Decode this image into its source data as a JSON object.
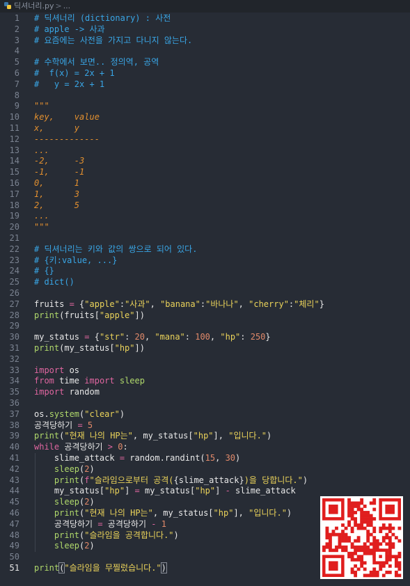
{
  "breadcrumb": {
    "filename": "딕셔너리.py",
    "separator": ">",
    "ellipsis": "..."
  },
  "brand": {
    "qr_color": "#e01e1e"
  },
  "current_line": 51,
  "lines": [
    {
      "n": 1,
      "tokens": [
        [
          "comment",
          "# 딕셔너리 (dictionary) : 사전"
        ]
      ]
    },
    {
      "n": 2,
      "tokens": [
        [
          "comment",
          "# apple -> 사과"
        ]
      ]
    },
    {
      "n": 3,
      "tokens": [
        [
          "comment",
          "# 요즘에는 사전을 가지고 다니지 않는다."
        ]
      ]
    },
    {
      "n": 4,
      "tokens": []
    },
    {
      "n": 5,
      "tokens": [
        [
          "comment",
          "# 수학에서 보면.. 정의역, 공역"
        ]
      ]
    },
    {
      "n": 6,
      "tokens": [
        [
          "comment",
          "#  f(x) = 2x + 1"
        ]
      ]
    },
    {
      "n": 7,
      "tokens": [
        [
          "comment",
          "#   y = 2x + 1"
        ]
      ]
    },
    {
      "n": 8,
      "tokens": []
    },
    {
      "n": 9,
      "tokens": [
        [
          "doc",
          "\"\"\""
        ]
      ]
    },
    {
      "n": 10,
      "tokens": [
        [
          "doc",
          "key,    value"
        ]
      ]
    },
    {
      "n": 11,
      "tokens": [
        [
          "doc",
          "x,      y"
        ]
      ]
    },
    {
      "n": 12,
      "tokens": [
        [
          "doc",
          "-------------"
        ]
      ]
    },
    {
      "n": 13,
      "tokens": [
        [
          "doc",
          "..."
        ]
      ]
    },
    {
      "n": 14,
      "tokens": [
        [
          "doc",
          "-2,     -3"
        ]
      ]
    },
    {
      "n": 15,
      "tokens": [
        [
          "doc",
          "-1,     -1"
        ]
      ]
    },
    {
      "n": 16,
      "tokens": [
        [
          "doc",
          "0,      1"
        ]
      ]
    },
    {
      "n": 17,
      "tokens": [
        [
          "doc",
          "1,      3"
        ]
      ]
    },
    {
      "n": 18,
      "tokens": [
        [
          "doc",
          "2,      5"
        ]
      ]
    },
    {
      "n": 19,
      "tokens": [
        [
          "doc",
          "..."
        ]
      ]
    },
    {
      "n": 20,
      "tokens": [
        [
          "doc",
          "\"\"\""
        ]
      ]
    },
    {
      "n": 21,
      "tokens": []
    },
    {
      "n": 22,
      "tokens": [
        [
          "comment",
          "# 딕셔너리는 키와 값의 쌍으로 되어 있다."
        ]
      ]
    },
    {
      "n": 23,
      "tokens": [
        [
          "comment",
          "# {키:value, ...}"
        ]
      ]
    },
    {
      "n": 24,
      "tokens": [
        [
          "comment",
          "# {}"
        ]
      ]
    },
    {
      "n": 25,
      "tokens": [
        [
          "comment",
          "# dict()"
        ]
      ]
    },
    {
      "n": 26,
      "tokens": []
    },
    {
      "n": 27,
      "tokens": [
        [
          "plain",
          "fruits "
        ],
        [
          "op",
          "="
        ],
        [
          "plain",
          " {"
        ],
        [
          "str",
          "\"apple\""
        ],
        [
          "plain",
          ":"
        ],
        [
          "str",
          "\"사과\""
        ],
        [
          "plain",
          ", "
        ],
        [
          "str",
          "\"banana\""
        ],
        [
          "plain",
          ":"
        ],
        [
          "str",
          "\"바나나\""
        ],
        [
          "plain",
          ", "
        ],
        [
          "str",
          "\"cherry\""
        ],
        [
          "plain",
          ":"
        ],
        [
          "str",
          "\"체리\""
        ],
        [
          "plain",
          "}"
        ]
      ]
    },
    {
      "n": 28,
      "tokens": [
        [
          "fn",
          "print"
        ],
        [
          "plain",
          "(fruits["
        ],
        [
          "str",
          "\"apple\""
        ],
        [
          "plain",
          "])"
        ]
      ]
    },
    {
      "n": 29,
      "tokens": []
    },
    {
      "n": 30,
      "tokens": [
        [
          "plain",
          "my_status "
        ],
        [
          "op",
          "="
        ],
        [
          "plain",
          " {"
        ],
        [
          "str",
          "\"str\""
        ],
        [
          "plain",
          ": "
        ],
        [
          "num",
          "20"
        ],
        [
          "plain",
          ", "
        ],
        [
          "str",
          "\"mana\""
        ],
        [
          "plain",
          ": "
        ],
        [
          "num",
          "100"
        ],
        [
          "plain",
          ", "
        ],
        [
          "str",
          "\"hp\""
        ],
        [
          "plain",
          ": "
        ],
        [
          "num",
          "250"
        ],
        [
          "plain",
          "}"
        ]
      ]
    },
    {
      "n": 31,
      "tokens": [
        [
          "fn",
          "print"
        ],
        [
          "plain",
          "(my_status["
        ],
        [
          "str",
          "\"hp\""
        ],
        [
          "plain",
          "])"
        ]
      ]
    },
    {
      "n": 32,
      "tokens": []
    },
    {
      "n": 33,
      "tokens": [
        [
          "kw",
          "import"
        ],
        [
          "plain",
          " os"
        ]
      ]
    },
    {
      "n": 34,
      "tokens": [
        [
          "kw",
          "from"
        ],
        [
          "plain",
          " time "
        ],
        [
          "kw",
          "import"
        ],
        [
          "plain",
          " "
        ],
        [
          "fn",
          "sleep"
        ]
      ]
    },
    {
      "n": 35,
      "tokens": [
        [
          "kw",
          "import"
        ],
        [
          "plain",
          " random"
        ]
      ]
    },
    {
      "n": 36,
      "tokens": []
    },
    {
      "n": 37,
      "tokens": [
        [
          "plain",
          "os."
        ],
        [
          "fn",
          "system"
        ],
        [
          "plain",
          "("
        ],
        [
          "str",
          "\"clear\""
        ],
        [
          "plain",
          ")"
        ]
      ]
    },
    {
      "n": 38,
      "tokens": [
        [
          "plain",
          "공격당하기 "
        ],
        [
          "op",
          "="
        ],
        [
          "plain",
          " "
        ],
        [
          "num",
          "5"
        ]
      ]
    },
    {
      "n": 39,
      "tokens": [
        [
          "fn",
          "print"
        ],
        [
          "plain",
          "("
        ],
        [
          "str",
          "\"현재 나의 HP는\""
        ],
        [
          "plain",
          ", my_status["
        ],
        [
          "str",
          "\"hp\""
        ],
        [
          "plain",
          "], "
        ],
        [
          "str",
          "\"입니다.\""
        ],
        [
          "plain",
          ")"
        ]
      ]
    },
    {
      "n": 40,
      "tokens": [
        [
          "kw",
          "while"
        ],
        [
          "plain",
          " 공격당하기 "
        ],
        [
          "op",
          ">"
        ],
        [
          "plain",
          " "
        ],
        [
          "num",
          "0"
        ],
        [
          "plain",
          ":"
        ]
      ]
    },
    {
      "n": 41,
      "tokens": [
        [
          "plain",
          "    slime_attack "
        ],
        [
          "op",
          "="
        ],
        [
          "plain",
          " random.randint("
        ],
        [
          "num",
          "15"
        ],
        [
          "plain",
          ", "
        ],
        [
          "num",
          "30"
        ],
        [
          "plain",
          ")"
        ]
      ]
    },
    {
      "n": 42,
      "tokens": [
        [
          "plain",
          "    "
        ],
        [
          "fn",
          "sleep"
        ],
        [
          "plain",
          "("
        ],
        [
          "num",
          "2"
        ],
        [
          "plain",
          ")"
        ]
      ]
    },
    {
      "n": 43,
      "tokens": [
        [
          "plain",
          "    "
        ],
        [
          "fn",
          "print"
        ],
        [
          "plain",
          "("
        ],
        [
          "kw",
          "f"
        ],
        [
          "str",
          "\"슬라임으로부터 공격("
        ],
        [
          "plain",
          "{slime_attack}"
        ],
        [
          "str",
          ")을 당합니다.\""
        ],
        [
          "plain",
          ")"
        ]
      ]
    },
    {
      "n": 44,
      "tokens": [
        [
          "plain",
          "    my_status["
        ],
        [
          "str",
          "\"hp\""
        ],
        [
          "plain",
          "] "
        ],
        [
          "op",
          "="
        ],
        [
          "plain",
          " my_status["
        ],
        [
          "str",
          "\"hp\""
        ],
        [
          "plain",
          "] "
        ],
        [
          "op",
          "-"
        ],
        [
          "plain",
          " slime_attack"
        ]
      ]
    },
    {
      "n": 45,
      "tokens": [
        [
          "plain",
          "    "
        ],
        [
          "fn",
          "sleep"
        ],
        [
          "plain",
          "("
        ],
        [
          "num",
          "2"
        ],
        [
          "plain",
          ")"
        ]
      ]
    },
    {
      "n": 46,
      "tokens": [
        [
          "plain",
          "    "
        ],
        [
          "fn",
          "print"
        ],
        [
          "plain",
          "("
        ],
        [
          "str",
          "\"현재 나의 HP는\""
        ],
        [
          "plain",
          ", my_status["
        ],
        [
          "str",
          "\"hp\""
        ],
        [
          "plain",
          "], "
        ],
        [
          "str",
          "\"입니다.\""
        ],
        [
          "plain",
          ")"
        ]
      ]
    },
    {
      "n": 47,
      "tokens": [
        [
          "plain",
          "    공격당하기 "
        ],
        [
          "op",
          "="
        ],
        [
          "plain",
          " 공격당하기 "
        ],
        [
          "op",
          "-"
        ],
        [
          "plain",
          " "
        ],
        [
          "num",
          "1"
        ]
      ]
    },
    {
      "n": 48,
      "tokens": [
        [
          "plain",
          "    "
        ],
        [
          "fn",
          "print"
        ],
        [
          "plain",
          "("
        ],
        [
          "str",
          "\"슬라임을 공격합니다.\""
        ],
        [
          "plain",
          ")"
        ]
      ]
    },
    {
      "n": 49,
      "tokens": [
        [
          "plain",
          "    "
        ],
        [
          "fn",
          "sleep"
        ],
        [
          "plain",
          "("
        ],
        [
          "num",
          "2"
        ],
        [
          "plain",
          ")"
        ]
      ]
    },
    {
      "n": 50,
      "tokens": []
    },
    {
      "n": 51,
      "tokens": [
        [
          "fn",
          "print"
        ],
        [
          "plain",
          "("
        ],
        [
          "str",
          "\"슬라임을 무찔렀습니다.\""
        ],
        [
          "plain",
          ")"
        ]
      ]
    }
  ]
}
